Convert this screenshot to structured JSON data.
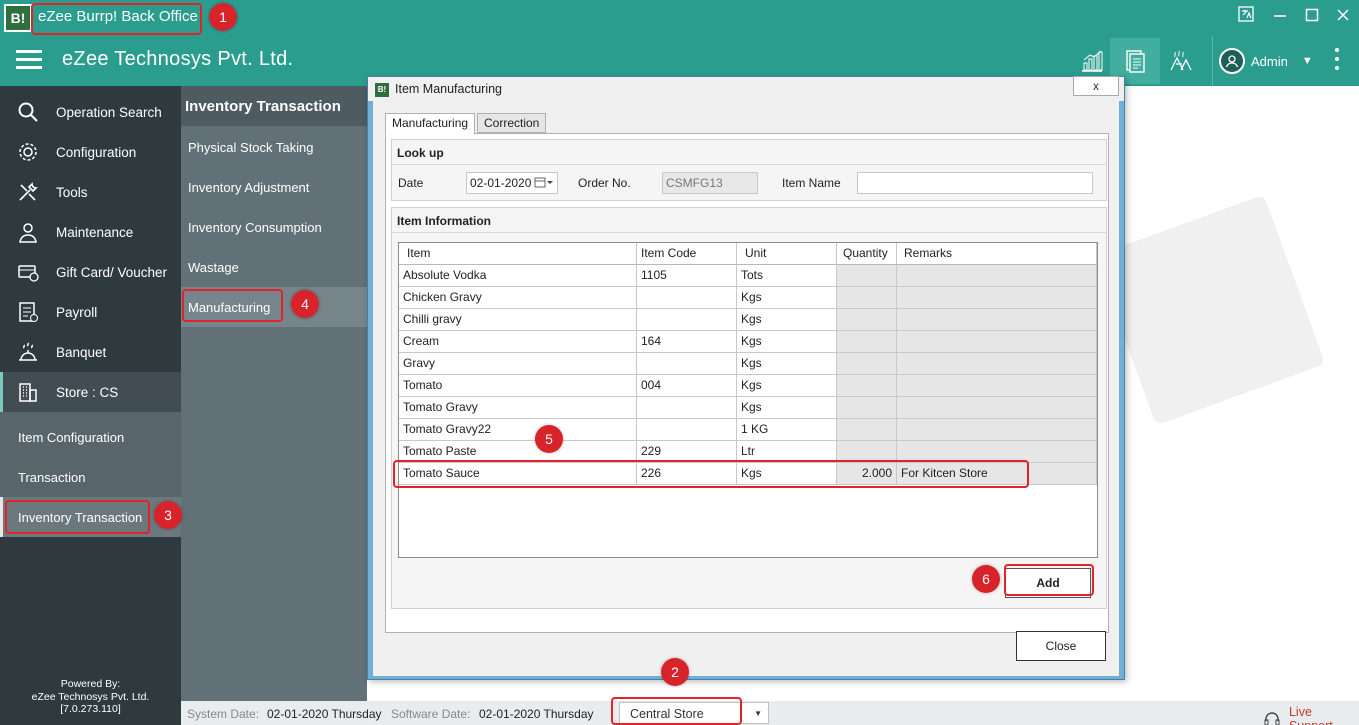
{
  "app": {
    "logo_text": "B!",
    "title": "eZee Burrp! Back Office"
  },
  "header": {
    "company_name": "eZee Technosys Pvt. Ltd.",
    "user_name": "Admin"
  },
  "sidebar": {
    "items": [
      {
        "label": "Operation Search",
        "icon": "search-icon"
      },
      {
        "label": "Configuration",
        "icon": "gear-icon"
      },
      {
        "label": "Tools",
        "icon": "tools-icon"
      },
      {
        "label": "Maintenance",
        "icon": "maintenance-icon"
      },
      {
        "label": "Gift Card/ Voucher",
        "icon": "gift-card-icon"
      },
      {
        "label": "Payroll",
        "icon": "payroll-icon"
      },
      {
        "label": "Banquet",
        "icon": "banquet-icon"
      },
      {
        "label": "Store : CS",
        "icon": "store-icon"
      }
    ],
    "sub_items": [
      {
        "label": "Item Configuration"
      },
      {
        "label": "Transaction"
      },
      {
        "label": "Inventory Transaction"
      }
    ],
    "powered_by": {
      "line1": "Powered By:",
      "line2": "eZee Technosys Pvt. Ltd.",
      "line3": "[7.0.273.110]"
    }
  },
  "inventory_menu": {
    "title": "Inventory Transaction",
    "items": [
      {
        "label": "Physical Stock Taking"
      },
      {
        "label": "Inventory Adjustment"
      },
      {
        "label": "Inventory Consumption"
      },
      {
        "label": "Wastage"
      },
      {
        "label": "Manufacturing"
      }
    ]
  },
  "statusbar": {
    "system_date_label": "System Date:",
    "system_date": "02-01-2020 Thursday",
    "software_date_label": "Software Date:",
    "software_date": "02-01-2020 Thursday",
    "store": "Central Store",
    "live_support": "Live Support"
  },
  "dialog": {
    "title": "Item Manufacturing",
    "close_glyph": "x",
    "tabs": [
      {
        "label": "Manufacturing"
      },
      {
        "label": "Correction"
      }
    ],
    "lookup": {
      "title": "Look up",
      "date_label": "Date",
      "date_value": "02-01-2020",
      "order_no_label": "Order No.",
      "order_no_value": "CSMFG13",
      "item_name_label": "Item Name",
      "item_name_value": ""
    },
    "item_info": {
      "title": "Item Information",
      "columns": [
        "Item",
        "Item Code",
        "Unit",
        "Quantity",
        "Remarks"
      ],
      "rows": [
        {
          "item": "Absolute Vodka",
          "code": "1105",
          "unit": "Tots",
          "qty": "",
          "remarks": ""
        },
        {
          "item": "Chicken Gravy",
          "code": "",
          "unit": "Kgs",
          "qty": "",
          "remarks": ""
        },
        {
          "item": "Chilli gravy",
          "code": "",
          "unit": "Kgs",
          "qty": "",
          "remarks": ""
        },
        {
          "item": "Cream",
          "code": "164",
          "unit": "Kgs",
          "qty": "",
          "remarks": ""
        },
        {
          "item": "Gravy",
          "code": "",
          "unit": "Kgs",
          "qty": "",
          "remarks": ""
        },
        {
          "item": "Tomato",
          "code": "004",
          "unit": "Kgs",
          "qty": "",
          "remarks": ""
        },
        {
          "item": "Tomato Gravy",
          "code": "",
          "unit": "Kgs",
          "qty": "",
          "remarks": ""
        },
        {
          "item": "Tomato Gravy22",
          "code": "",
          "unit": "1 KG",
          "qty": "",
          "remarks": ""
        },
        {
          "item": "Tomato Paste",
          "code": "229",
          "unit": "Ltr",
          "qty": "",
          "remarks": ""
        },
        {
          "item": "Tomato Sauce",
          "code": "226",
          "unit": "Kgs",
          "qty": "2.000",
          "remarks": "For Kitcen Store"
        }
      ]
    },
    "add_label": "Add",
    "close_label": "Close"
  },
  "annotations": [
    "1",
    "2",
    "3",
    "4",
    "5",
    "6"
  ],
  "colors": {
    "header_teal": "#2a9d8f",
    "sidebar_dark": "#2f3a3f",
    "annotation_red": "#e1242a",
    "live_support_red": "#c0392b"
  }
}
